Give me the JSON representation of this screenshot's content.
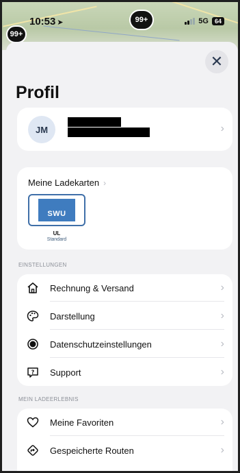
{
  "status_bar": {
    "time": "10:53",
    "network": "5G",
    "battery": "64",
    "badge_left": "99+",
    "badge_center": "99+"
  },
  "page": {
    "title": "Profil",
    "close_glyph": "✕"
  },
  "profile": {
    "initials": "JM"
  },
  "charge_cards": {
    "heading": "Meine Ladekarten",
    "items": [
      {
        "logo_text": "SWU",
        "code": "UL",
        "type": "Standard"
      }
    ]
  },
  "settings": {
    "section_label": "EINSTELLUNGEN",
    "items": [
      {
        "label": "Rechnung & Versand",
        "icon": "house-icon"
      },
      {
        "label": "Darstellung",
        "icon": "palette-icon"
      },
      {
        "label": "Datenschutzeinstellungen",
        "icon": "privacy-icon"
      },
      {
        "label": "Support",
        "icon": "help-icon"
      }
    ]
  },
  "experience": {
    "section_label": "MEIN LADEERLEBNIS",
    "items": [
      {
        "label": "Meine Favoriten",
        "icon": "heart-icon"
      },
      {
        "label": "Gespeicherte Routen",
        "icon": "route-icon"
      }
    ]
  },
  "colors": {
    "accent": "#3f6fa8",
    "background": "#f2f2f4",
    "card": "#ffffff"
  }
}
